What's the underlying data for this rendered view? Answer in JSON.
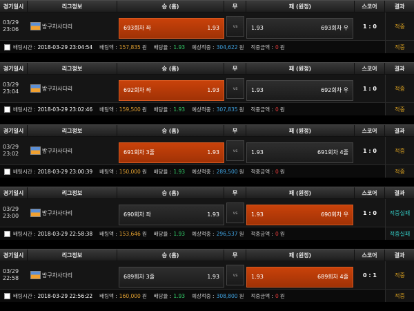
{
  "headers": {
    "time": "경기일시",
    "league": "리그정보",
    "win": "승 (홈)",
    "draw": "무",
    "lose": "패 (원정)",
    "score": "스코어",
    "result": "결과"
  },
  "labels": {
    "vs": "vs",
    "bet_time": "배팅시간 :",
    "bet_amount": "배팅액 :",
    "odds": "배당율 :",
    "expected": "예상적중 :",
    "hit_amount": "적중금액 :",
    "won": "원"
  },
  "bets": [
    {
      "date": "03/29",
      "time": "23:06",
      "league": "방구차사다리",
      "win_label": "693회차 좌",
      "win_odds": "1.93",
      "lose_odds": "1.93",
      "lose_label": "693회차 우",
      "selected": "win",
      "score": "1 : 0",
      "result": "적중",
      "bet_time": "2018-03-29 23:04:54",
      "bet_amount": "157,835",
      "odds": "1.93",
      "expected": "304,622",
      "hit_amount": "0",
      "result_badge": "적중",
      "result_type": "hit"
    },
    {
      "date": "03/29",
      "time": "23:04",
      "league": "방구차사다리",
      "win_label": "692회차 좌",
      "win_odds": "1.93",
      "lose_odds": "1.93",
      "lose_label": "692회차 우",
      "selected": "win",
      "score": "1 : 0",
      "result": "적중",
      "bet_time": "2018-03-29 23:02:46",
      "bet_amount": "159,500",
      "odds": "1.93",
      "expected": "307,835",
      "hit_amount": "0",
      "result_badge": "적중",
      "result_type": "hit"
    },
    {
      "date": "03/29",
      "time": "23:02",
      "league": "방구차사다리",
      "win_label": "691회차 3줄",
      "win_odds": "1.93",
      "lose_odds": "1.93",
      "lose_label": "691회차 4줄",
      "selected": "win",
      "score": "1 : 0",
      "result": "적중",
      "bet_time": "2018-03-29 23:00:39",
      "bet_amount": "150,000",
      "odds": "1.93",
      "expected": "289,500",
      "hit_amount": "0",
      "result_badge": "적중",
      "result_type": "hit"
    },
    {
      "date": "03/29",
      "time": "23:00",
      "league": "방구차사다리",
      "win_label": "690회차 좌",
      "win_odds": "1.93",
      "lose_odds": "1.93",
      "lose_label": "690회차 우",
      "selected": "lose",
      "score": "1 : 0",
      "result": "적중실패",
      "bet_time": "2018-03-29 22:58:38",
      "bet_amount": "153,646",
      "odds": "1.93",
      "expected": "296,537",
      "hit_amount": "0",
      "result_badge": "적중실패",
      "result_type": "miss"
    },
    {
      "date": "03/29",
      "time": "22:58",
      "league": "방구차사다리",
      "win_label": "689회차 3줄",
      "win_odds": "1.93",
      "lose_odds": "1.93",
      "lose_label": "689회차 4줄",
      "selected": "lose",
      "score": "0 : 1",
      "result": "적중",
      "bet_time": "2018-03-29 22:56:22",
      "bet_amount": "160,000",
      "odds": "1.93",
      "expected": "308,800",
      "hit_amount": "0",
      "result_badge": "적중",
      "result_type": "hit"
    }
  ]
}
